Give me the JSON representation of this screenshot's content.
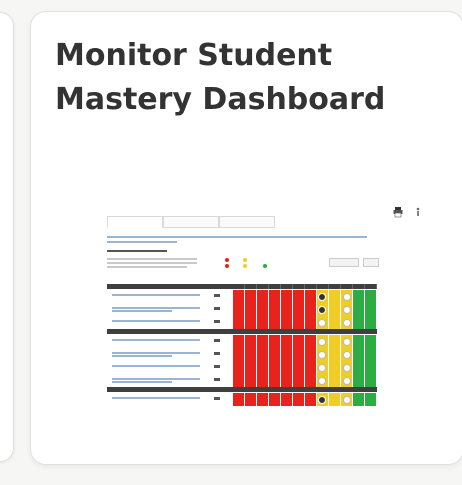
{
  "card": {
    "title_lines": [
      "Monitor Student",
      "Mastery Dashboard"
    ]
  },
  "preview": {
    "description_hidden": true,
    "colors": {
      "red": "#e8231d",
      "yellow": "#f0cc26",
      "green": "#2dac44",
      "header": "#3f3f3f",
      "link": "#9ab4d6",
      "active_tab": "#e34a3a"
    },
    "icons": [
      "printer-icon",
      "info-icon"
    ],
    "sections": [
      {
        "rows": [
          {
            "red": 7,
            "yellow": 3,
            "green": 2,
            "marker": "dark"
          },
          {
            "red": 7,
            "yellow": 3,
            "green": 2,
            "marker": "dark"
          },
          {
            "red": 7,
            "yellow": 3,
            "green": 2,
            "marker": "light"
          }
        ]
      },
      {
        "rows": [
          {
            "red": 7,
            "yellow": 3,
            "green": 2,
            "marker": "light"
          },
          {
            "red": 7,
            "yellow": 3,
            "green": 2,
            "marker": "light"
          },
          {
            "red": 7,
            "yellow": 3,
            "green": 2,
            "marker": "light"
          },
          {
            "red": 7,
            "yellow": 3,
            "green": 2,
            "marker": "light"
          }
        ]
      },
      {
        "rows": [
          {
            "red": 7,
            "yellow": 3,
            "green": 2,
            "marker": "dark"
          }
        ]
      }
    ]
  }
}
